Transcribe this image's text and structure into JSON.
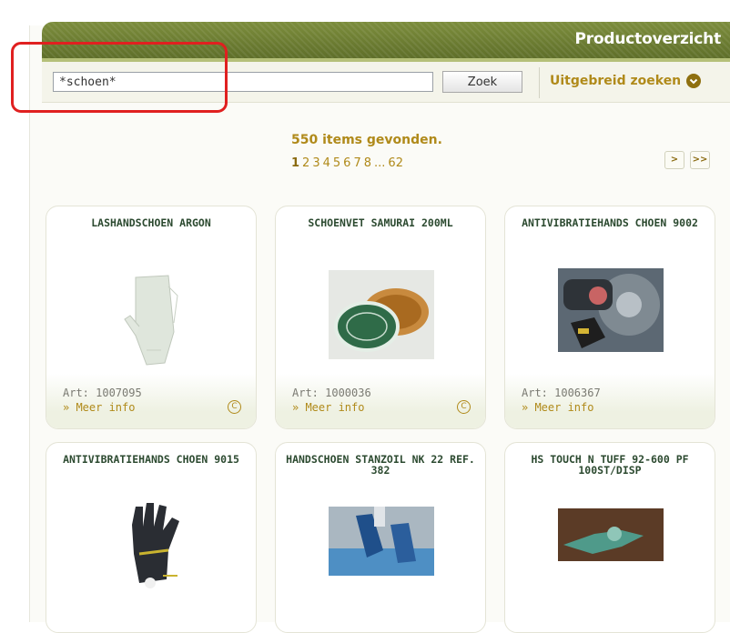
{
  "header": {
    "title": "Productoverzicht"
  },
  "search": {
    "value": "*schoen*",
    "button_label": "Zoek",
    "advanced_label": "Uitgebreid zoeken",
    "advanced_icon": "chevron-down-icon"
  },
  "results": {
    "count_label": "550 items gevonden.",
    "pages": [
      "1",
      "2",
      "3",
      "4",
      "5",
      "6",
      "7",
      "8",
      "...",
      "62"
    ],
    "current_page": "1",
    "next_label": ">",
    "last_label": ">>"
  },
  "products": [
    {
      "name": "LASHANDSCHOEN ARGON",
      "art": "Art: 1007095",
      "more": "» Meer info",
      "badge": "C",
      "image": "leather-glove-image"
    },
    {
      "name": "SCHOENVET SAMURAI 200ML",
      "art": "Art: 1000036",
      "more": "» Meer info",
      "badge": "C",
      "image": "shoe-polish-tin-image"
    },
    {
      "name": "ANTIVIBRATIEHANDS CHOEN 9002",
      "art": "Art: 1006367",
      "more": "» Meer info",
      "badge": "",
      "image": "gloved-hand-wheel-image"
    },
    {
      "name": "ANTIVIBRATIEHANDS CHOEN 9015",
      "art": "",
      "more": "",
      "badge": "",
      "image": "black-glove-image"
    },
    {
      "name": "HANDSCHOEN STANZOIL NK 22 REF. 382",
      "art": "",
      "more": "",
      "badge": "",
      "image": "blue-glove-image"
    },
    {
      "name": "HS TOUCH N TUFF 92-600 PF 100ST/DISP",
      "art": "",
      "more": "",
      "badge": "",
      "image": "green-disposable-glove-image"
    }
  ],
  "colors": {
    "header_green": "#6b7b32",
    "accent_gold": "#b08a1a",
    "highlight_red": "#e02020"
  }
}
